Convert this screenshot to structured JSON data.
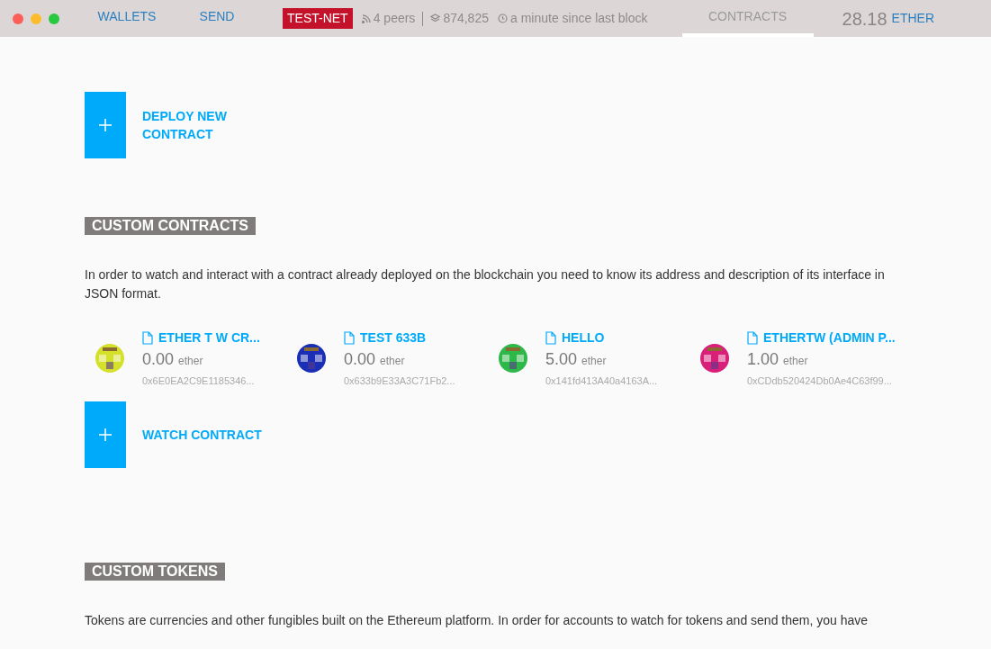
{
  "nav": {
    "tabs": [
      {
        "label": "WALLETS",
        "selected": false
      },
      {
        "label": "SEND",
        "selected": false
      },
      {
        "label": "CONTRACTS",
        "selected": true
      }
    ],
    "network": "TEST-NET",
    "peers": "4 peers",
    "block": "874,825",
    "since": "a minute since last block",
    "balance": "28.18",
    "unit": "ETHER"
  },
  "deploy_button": "DEPLOY NEW CONTRACT",
  "custom_contracts": {
    "heading": "CUSTOM CONTRACTS",
    "description": "In order to watch and interact with a contract already deployed on the blockchain you need to know its address and description of its interface in JSON format.",
    "contracts": [
      {
        "name": "ETHER T W CR...",
        "amount": "0.00",
        "unit": "ether",
        "address": "0x6E0EA2C9E1185346...",
        "color": "#d4e02a"
      },
      {
        "name": "TEST 633B",
        "amount": "0.00",
        "unit": "ether",
        "address": "0x633b9E33A3C71Fb2...",
        "color": "#1a2fb5"
      },
      {
        "name": "HELLO",
        "amount": "5.00",
        "unit": "ether",
        "address": "0x141fd413A40a4163A...",
        "color": "#2fb84a"
      },
      {
        "name": "ETHERTW (ADMIN P...",
        "amount": "1.00",
        "unit": "ether",
        "address": "0xCDdb520424Db0Ae4C63f99...",
        "color": "#d81f7a"
      }
    ],
    "watch_button": "WATCH CONTRACT"
  },
  "custom_tokens": {
    "heading": "CUSTOM TOKENS",
    "description": "Tokens are currencies and other fungibles built on the Ethereum platform. In order for accounts to watch for tokens and send them, you have"
  }
}
